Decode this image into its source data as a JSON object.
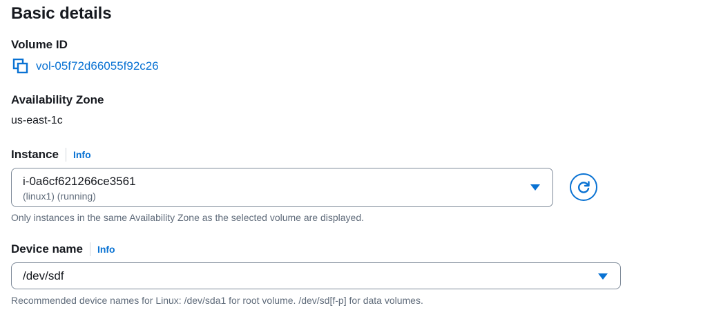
{
  "section": {
    "title": "Basic details"
  },
  "volume": {
    "label": "Volume ID",
    "value": "vol-05f72d66055f92c26"
  },
  "availability_zone": {
    "label": "Availability Zone",
    "value": "us-east-1c"
  },
  "instance": {
    "label": "Info_placeholder",
    "label_text": "Instance",
    "info": "Info",
    "selected_value": "i-0a6cf621266ce3561",
    "selected_detail": "(linux1) (running)",
    "hint": "Only instances in the same Availability Zone as the selected volume are displayed."
  },
  "device": {
    "label_text": "Device name",
    "info": "Info",
    "selected_value": "/dev/sdf",
    "hint": "Recommended device names for Linux: /dev/sda1 for root volume. /dev/sd[f-p] for data volumes."
  },
  "icons": {
    "copy": "copy-icon",
    "refresh": "refresh-icon",
    "caret": "caret-down-icon"
  },
  "colors": {
    "accent": "#0972d3",
    "text": "#16191f",
    "muted": "#5f6b7a",
    "border": "#7d8998"
  }
}
